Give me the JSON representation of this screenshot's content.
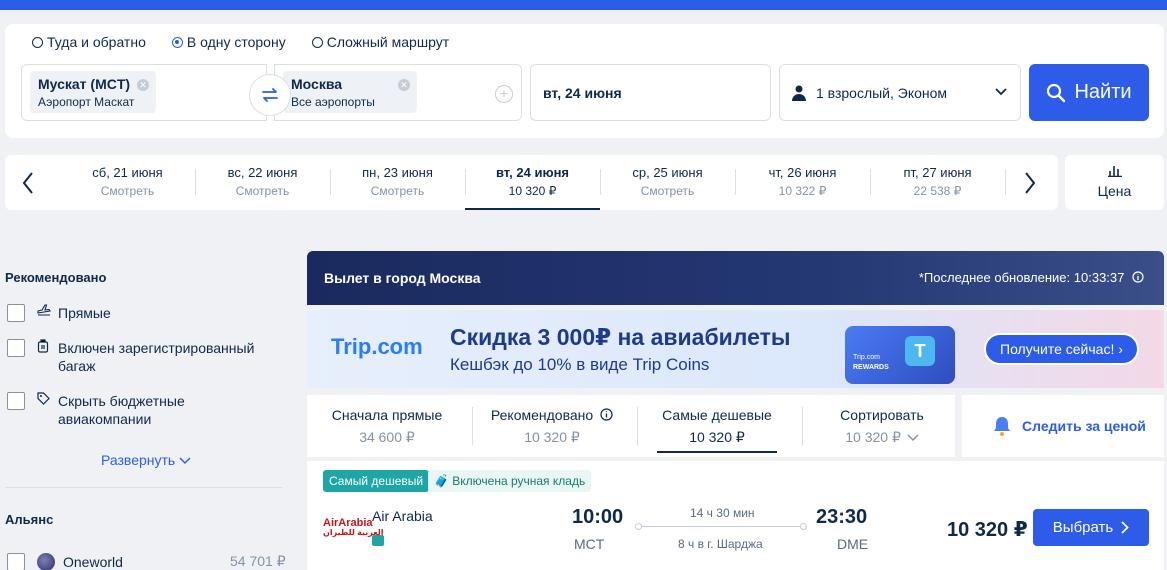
{
  "search": {
    "trip_types": [
      {
        "label": "Туда и обратно",
        "selected": false
      },
      {
        "label": "В одну сторону",
        "selected": true
      },
      {
        "label": "Сложный маршрут",
        "selected": false
      }
    ],
    "from": {
      "title": "Мускат (MCT)",
      "subtitle": "Аэропорт Маскат"
    },
    "to": {
      "title": "Москва",
      "subtitle": "Все аэропорты"
    },
    "date": "вт, 24 июня",
    "passengers": "1 взрослый, Эконом",
    "search_button": "Найти"
  },
  "datebar": {
    "dates": [
      {
        "date": "сб, 21 июня",
        "price": "Смотреть",
        "active": false
      },
      {
        "date": "вс, 22 июня",
        "price": "Смотреть",
        "active": false
      },
      {
        "date": "пн, 23 июня",
        "price": "Смотреть",
        "active": false
      },
      {
        "date": "вт, 24 июня",
        "price": "10 320 ₽",
        "active": true
      },
      {
        "date": "ср, 25 июня",
        "price": "Смотреть",
        "active": false
      },
      {
        "date": "чт, 26 июня",
        "price": "10 322 ₽",
        "active": false
      },
      {
        "date": "пт, 27 июня",
        "price": "22 538 ₽",
        "active": false
      }
    ],
    "price_toggle": "Цена"
  },
  "sidebar": {
    "recommended_title": "Рекомендовано",
    "filters": [
      {
        "label": "Прямые",
        "icon": "plane-icon"
      },
      {
        "label": "Включен зарегистрированный багаж",
        "icon": "luggage-icon"
      },
      {
        "label": "Скрыть бюджетные авиакомпании",
        "icon": "tag-icon"
      }
    ],
    "expand_label": "Развернуть",
    "alliance_title": "Альянс",
    "alliances": [
      {
        "label": "Oneworld",
        "price": "54 701 ₽"
      }
    ]
  },
  "results": {
    "header_title": "Вылет в город Москва",
    "last_update": "*Последнее обновление: 10:33:37",
    "banner": {
      "logo": "Trip.com",
      "line1": "Скидка 3 000₽ на авиабилеты",
      "line2": "Кешбэк до 10% в виде Trip Coins",
      "card_small": "Trip.com",
      "card_rewards": "REWARDS",
      "cta": "Получите сейчас!"
    },
    "sort": [
      {
        "label": "Сначала прямые",
        "price": "34 600 ₽",
        "active": false
      },
      {
        "label": "Рекомендовано",
        "price": "10 320 ₽",
        "active": false
      },
      {
        "label": "Самые дешевые",
        "price": "10 320 ₽",
        "active": true
      },
      {
        "label": "Сортировать",
        "price": "10 320 ₽",
        "active": false
      }
    ],
    "track_price": "Следить за ценой",
    "flights": [
      {
        "badge_cheapest": "Самый дешевый",
        "badge_baggage": "Включена ручная кладь",
        "airline_logo": "AirArabia",
        "airline_logo_ar": "العربية للطيران",
        "airline": "Air Arabia",
        "dep_time": "10:00",
        "dep_airport": "MCT",
        "duration": "14 ч 30 мин",
        "stops": "8 ч в г. Шарджа",
        "arr_time": "23:30",
        "arr_airport": "DME",
        "price": "10 320 ₽",
        "select": "Выбрать"
      }
    ]
  },
  "colors": {
    "accent": "#2c5ce8",
    "text": "#0f294d",
    "muted": "#8592a6",
    "badge": "#1ea6a6"
  }
}
